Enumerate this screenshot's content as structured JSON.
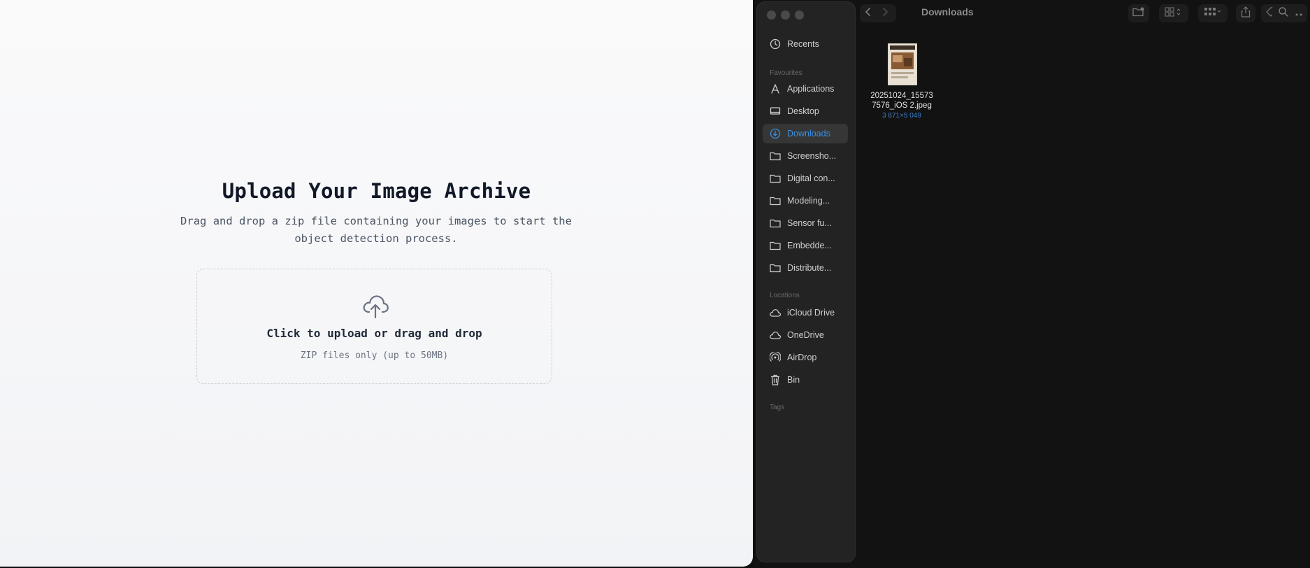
{
  "upload": {
    "title": "Upload Your Image Archive",
    "subtitle": "Drag and drop a zip file containing your images to start the object detection process.",
    "dropzone_label": "Click to upload or drag and drop",
    "dropzone_hint": "ZIP files only (up to 50MB)",
    "icon": "cloud-upload-icon"
  },
  "finder": {
    "window_title": "Downloads",
    "sidebar": {
      "recents": {
        "label": "Recents",
        "icon": "clock-icon"
      },
      "favourites_heading": "Favourites",
      "favourites": [
        {
          "label": "Applications",
          "icon": "applications-icon"
        },
        {
          "label": "Desktop",
          "icon": "desktop-icon"
        },
        {
          "label": "Downloads",
          "icon": "download-icon",
          "active": true
        },
        {
          "label": "Screensho...",
          "icon": "folder-icon"
        },
        {
          "label": "Digital con...",
          "icon": "folder-icon"
        },
        {
          "label": "Modeling...",
          "icon": "folder-icon"
        },
        {
          "label": "Sensor fu...",
          "icon": "folder-icon"
        },
        {
          "label": "Embedde...",
          "icon": "folder-icon"
        },
        {
          "label": "Distribute...",
          "icon": "folder-icon"
        }
      ],
      "locations_heading": "Locations",
      "locations": [
        {
          "label": "iCloud Drive",
          "icon": "cloud-icon"
        },
        {
          "label": "OneDrive",
          "icon": "cloud-icon"
        },
        {
          "label": "AirDrop",
          "icon": "airdrop-icon"
        },
        {
          "label": "Bin",
          "icon": "trash-icon"
        }
      ],
      "tags_heading": "Tags"
    },
    "files": [
      {
        "name_line1": "20251024_15573",
        "name_line2": "7576_iOS 2.jpeg",
        "dimensions": "3 871×5 049"
      }
    ],
    "colors": {
      "accent": "#3b8fe0",
      "sidebar_bg": "#232323",
      "content_bg": "#121212"
    }
  }
}
